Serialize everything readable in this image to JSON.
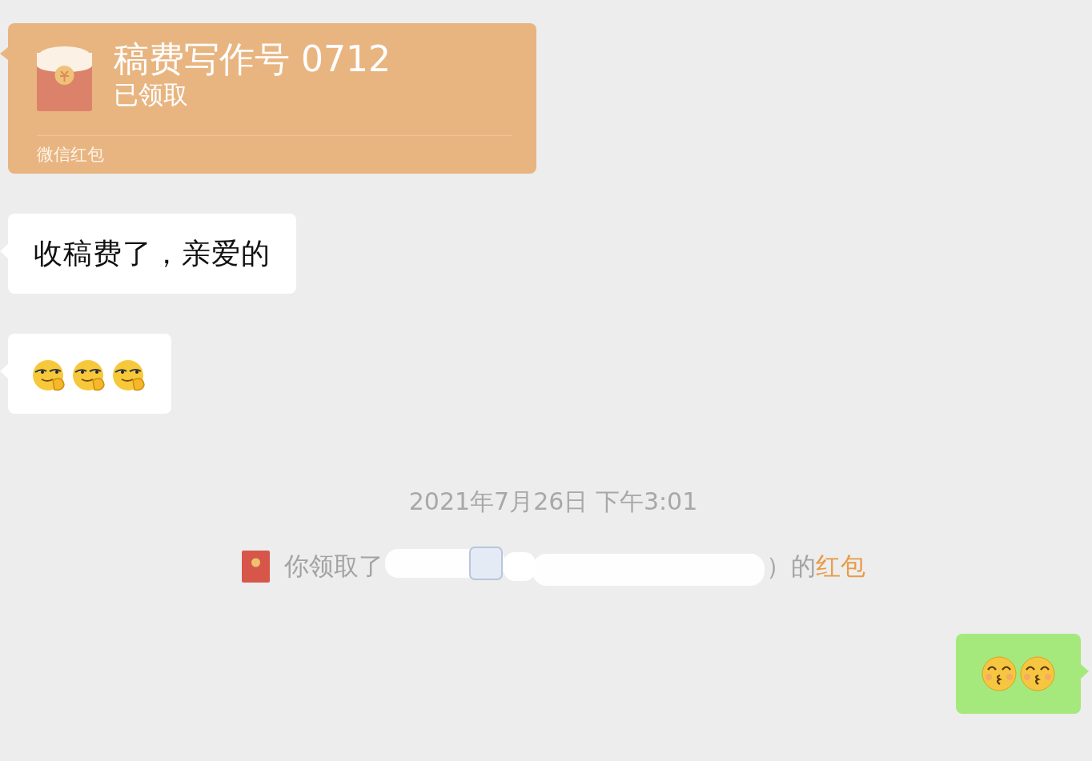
{
  "messages": [
    {
      "kind": "red_packet",
      "outgoing": false,
      "title": "稿费写作号 0712",
      "status": "已领取",
      "footer": "微信红包"
    },
    {
      "kind": "text",
      "outgoing": false,
      "text": "收稿费了，亲爱的"
    },
    {
      "kind": "emoji",
      "outgoing": false,
      "emojis": [
        {
          "kind": "smirk"
        },
        {
          "kind": "smirk"
        },
        {
          "kind": "smirk"
        }
      ]
    },
    {
      "kind": "timestamp",
      "text": "2021年7月26日 下午3:01"
    },
    {
      "kind": "system",
      "text": "你领取了",
      "tail": "）的",
      "link": "红包"
    },
    {
      "kind": "emoji",
      "outgoing": true,
      "emojis": [
        {
          "kind": "kiss"
        },
        {
          "kind": "kiss"
        }
      ]
    }
  ]
}
